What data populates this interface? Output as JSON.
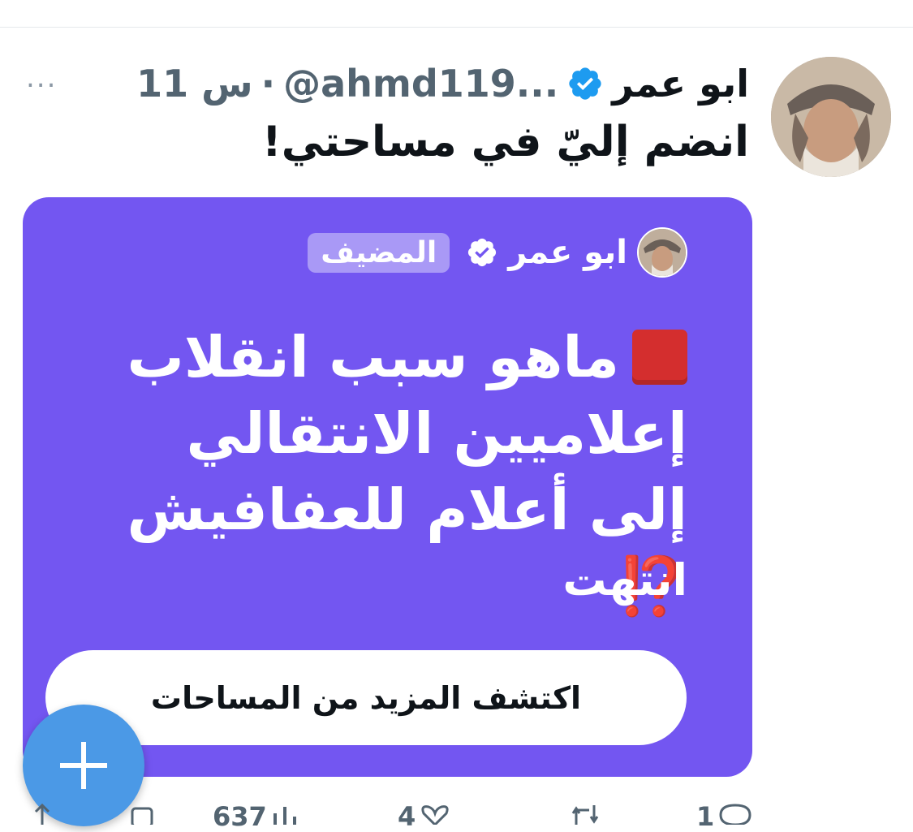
{
  "tweet": {
    "author_name": "ابو عمر",
    "handle": "@ahmd119...",
    "separator": "·",
    "time": "11 س",
    "text": "انضم إليّ في مساحتي!",
    "more_label": "..."
  },
  "space": {
    "host_name": "ابو عمر",
    "host_badge": "المضيف",
    "title": "ماهو سبب انقلاب إعلاميين الانتقالي إلى أعلام للعفافيش",
    "title_emoji": "⁉️",
    "status": "انتهت",
    "explore_button": "اكتشف المزيد من المساحات"
  },
  "actions": {
    "reply_count": "1",
    "retweet_count": "",
    "like_count": "4",
    "views_count": "637"
  },
  "colors": {
    "space_card": "#7356f1",
    "verified": "#1d9bf0",
    "fab": "#4b99e6"
  }
}
